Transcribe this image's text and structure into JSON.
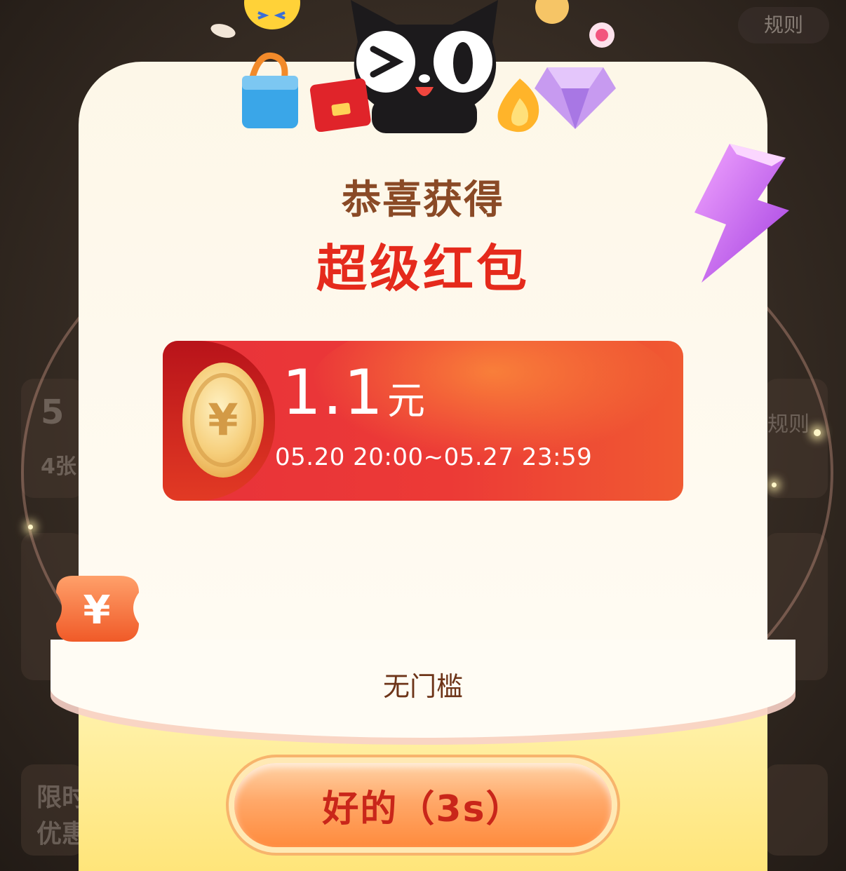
{
  "background": {
    "rules_label": "规则",
    "partial_texts": [
      "5",
      "4张",
      "规则",
      "限时",
      "优惠"
    ]
  },
  "modal": {
    "title": "恭喜获得",
    "subtitle": "超级红包",
    "coupon": {
      "amount": "1.1",
      "unit": "元",
      "validity": "05.20 20:00~05.27 23:59",
      "coin_symbol": "¥"
    },
    "threshold_text": "无门槛",
    "ok_button": "好的（3s）"
  },
  "icons": {
    "mascot": "tmall-cat-icon",
    "lightning": "lightning-icon",
    "yen_badge": "yen-badge-icon"
  },
  "colors": {
    "title_brown": "#8a4a26",
    "subtitle_red": "#e52a1c",
    "coupon_red": "#e8323a",
    "button_orange": "#ff8b3d"
  }
}
